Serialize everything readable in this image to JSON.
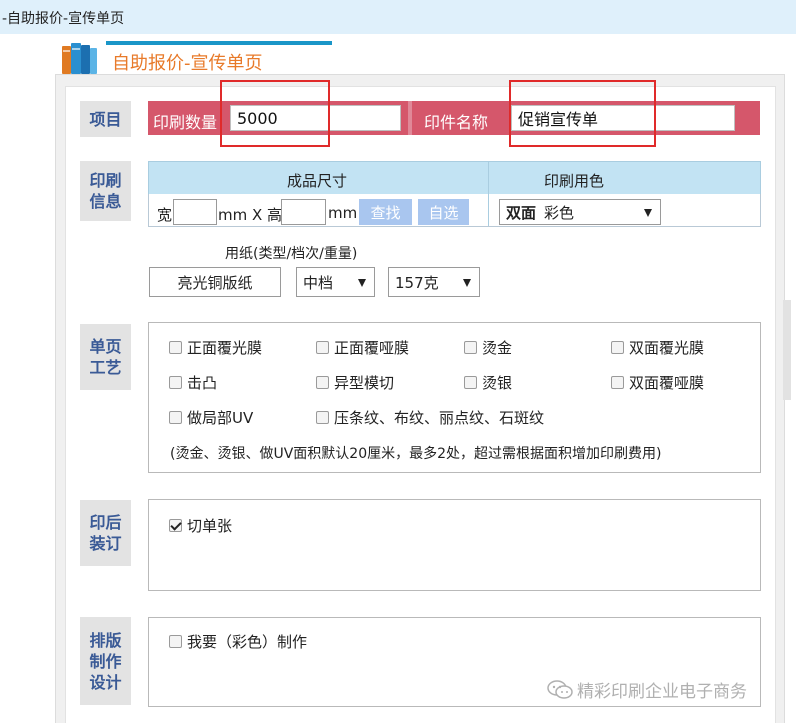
{
  "window": {
    "title": "-自助报价-宣传单页"
  },
  "header": {
    "title": "自助报价-宣传单页",
    "icon": "books-icon"
  },
  "sections": {
    "item": "项目",
    "print_info": [
      "印刷",
      "信息"
    ],
    "single_page_craft": [
      "单页",
      "工艺"
    ],
    "post_print_binding": [
      "印后",
      "装订"
    ],
    "layout_design": [
      "排版",
      "制作",
      "设计"
    ]
  },
  "item_row": {
    "quantity_label": "印刷数量",
    "quantity_value": "5000",
    "name_label": "印件名称",
    "name_value": "促销宣传单"
  },
  "print_info": {
    "size_header": "成品尺寸",
    "color_header": "印刷用色",
    "width_label": "宽",
    "width_value": "",
    "unit1": "mm X 高",
    "height_value": "",
    "unit2": "mm",
    "find_button": "查找",
    "custom_button": "自选",
    "color_select_bold": "双面",
    "color_select_value": "彩色",
    "paper_label": "用纸(类型/档次/重量)",
    "paper_type": "亮光铜版纸",
    "paper_grade": "中档",
    "paper_weight": "157克"
  },
  "craft": {
    "options": [
      {
        "label": "正面覆光膜",
        "checked": false
      },
      {
        "label": "正面覆哑膜",
        "checked": false
      },
      {
        "label": "烫金",
        "checked": false
      },
      {
        "label": "双面覆光膜",
        "checked": false
      },
      {
        "label": "击凸",
        "checked": false
      },
      {
        "label": "异型模切",
        "checked": false
      },
      {
        "label": "烫银",
        "checked": false
      },
      {
        "label": "双面覆哑膜",
        "checked": false
      },
      {
        "label": "做局部UV",
        "checked": false
      },
      {
        "label": "压条纹、布纹、丽点纹、石斑纹",
        "checked": false
      }
    ],
    "note": "(烫金、烫银、做UV面积默认20厘米，最多2处，超过需根据面积增加印刷费用)"
  },
  "binding": {
    "options": [
      {
        "label": "切单张",
        "checked": true
      }
    ]
  },
  "design": {
    "options": [
      {
        "label": "我要（彩色）制作",
        "checked": false
      }
    ]
  },
  "watermark": {
    "text": "精彩印刷企业电子商务",
    "icon": "wechat-icon"
  }
}
